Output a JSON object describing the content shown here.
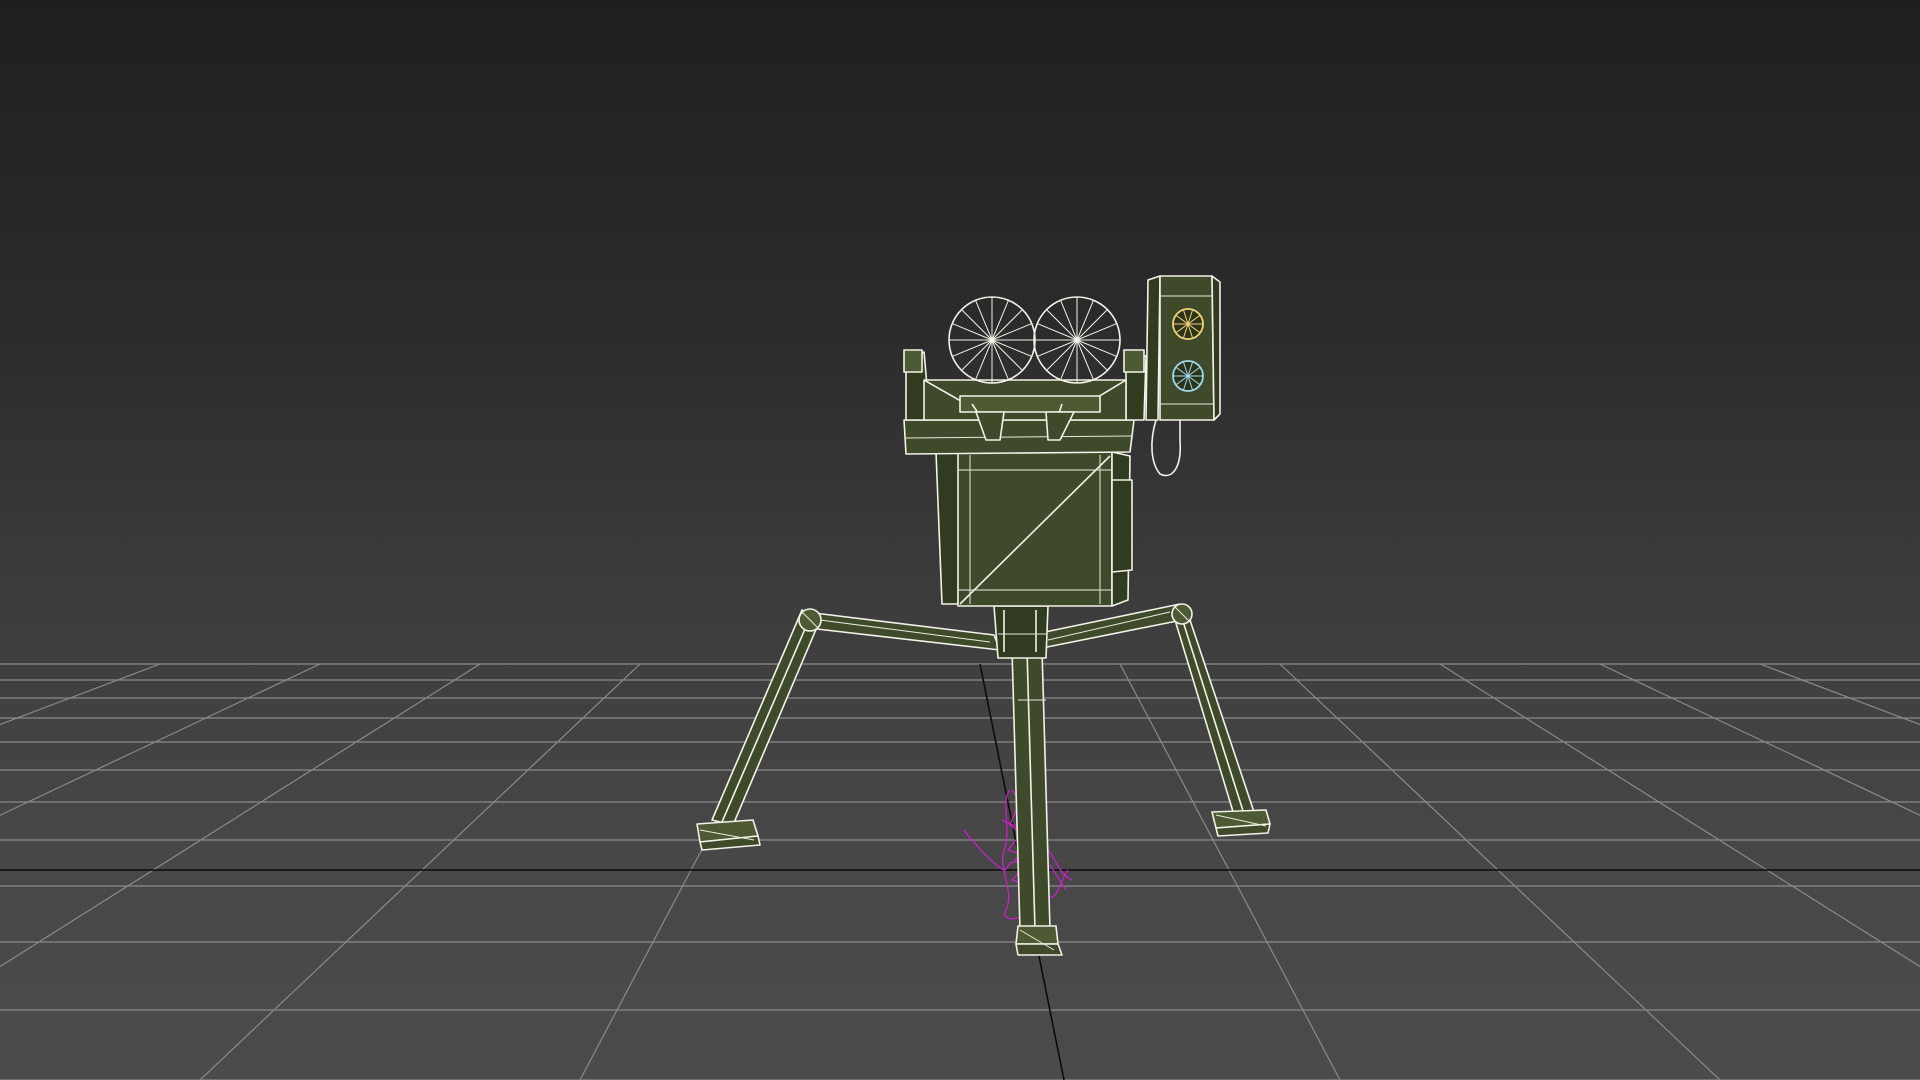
{
  "app": {
    "view": "perspective-viewport"
  },
  "scene": {
    "background_top": "#1f1f1f",
    "background_bottom": "#4b4b4b",
    "grid_color": "#8a8a8a",
    "axis_color": "#0c0c0c",
    "wireframe_color": "#f2f2e8",
    "model_color": "#3f4a2a",
    "helper_color": "#d21ecf",
    "objects": [
      {
        "name": "tripod-turret-model",
        "display": "wireframe-on-shaded"
      },
      {
        "name": "helper-object",
        "display": "wireframe"
      }
    ]
  }
}
